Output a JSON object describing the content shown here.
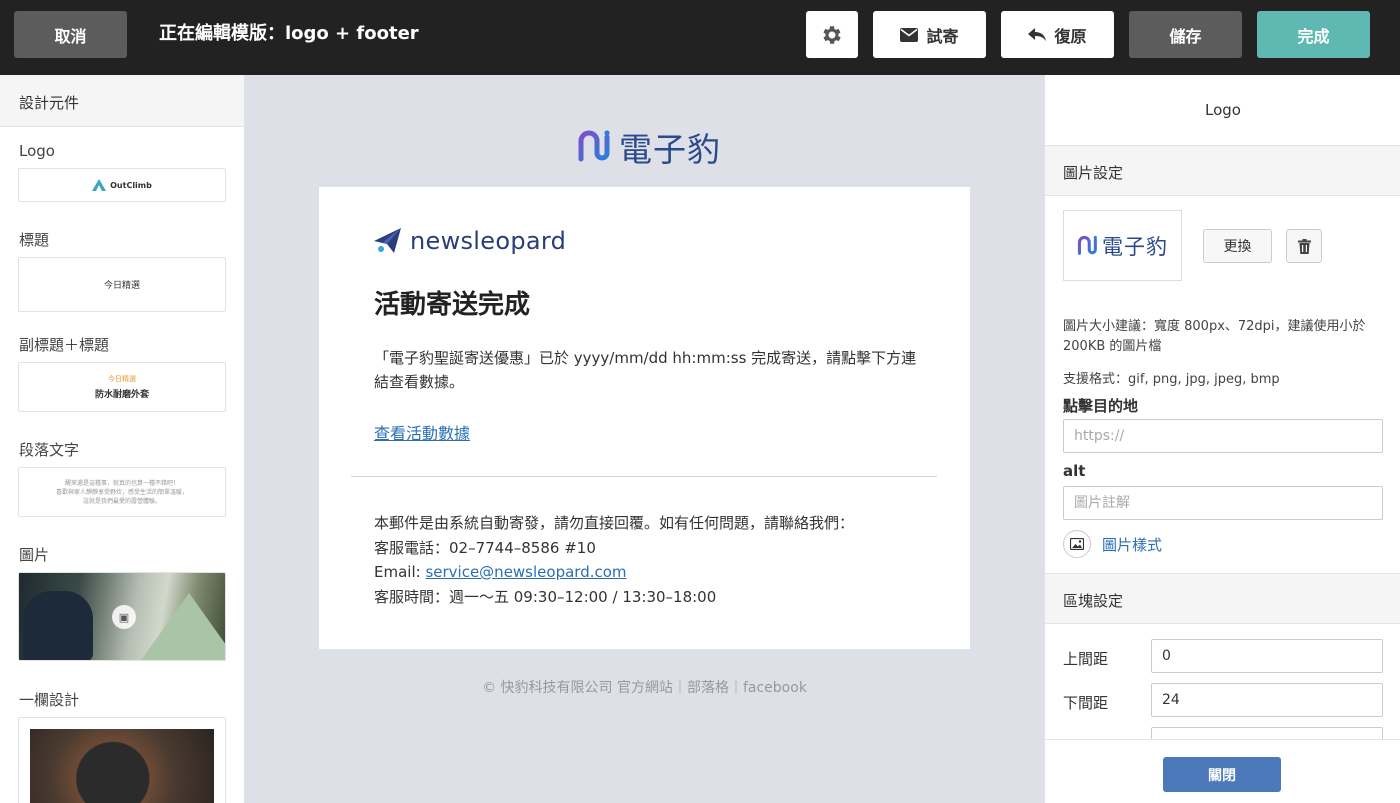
{
  "topbar": {
    "cancel_label": "取消",
    "title": "正在編輯模版：logo + footer",
    "test_send_label": "試寄",
    "restore_label": "復原",
    "save_label": "儲存",
    "done_label": "完成"
  },
  "left": {
    "header": "設計元件",
    "components": [
      {
        "label": "Logo",
        "preview": "OutClimb"
      },
      {
        "label": "標題",
        "preview": "今日精選"
      },
      {
        "label": "副標題＋標題",
        "preview_sub": "今日精選",
        "preview_title": "防水耐磨外套"
      },
      {
        "label": "段落文字",
        "preview_lines": [
          "醒來還是這種事，就真的也算一種不錯吧！",
          "喜歡與家人靜靜享受野炊，感受生活的簡單溫暖，",
          "這就是我們最愛的露營體驗。"
        ]
      },
      {
        "label": "圖片"
      },
      {
        "label": "一欄設計"
      }
    ]
  },
  "canvas": {
    "top_logo_text": "電子豹",
    "card": {
      "logo_text": "newsleopard",
      "heading": "活動寄送完成",
      "paragraph": "「電子豹聖誕寄送優惠」已於 yyyy/mm/dd hh:mm:ss 完成寄送，請點擊下方連結查看數據。",
      "link_text": "查看活動數據",
      "footer_line1": "本郵件是由系統自動寄發，請勿直接回覆。如有任何問題，請聯絡我們：",
      "footer_line2": "客服電話：02–7744–8586 #10",
      "footer_email_label": "Email: ",
      "footer_email": "service@newsleopard.com",
      "footer_line4": "客服時間：週一～五 09:30–12:00 / 13:30–18:00"
    },
    "copyright": "© 快豹科技有限公司 官方網站｜部落格｜facebook"
  },
  "right": {
    "title": "Logo",
    "image_section": "圖片設定",
    "thumb_text": "電子豹",
    "replace_label": "更換",
    "size_hint": "圖片大小建議：寬度 800px、72dpi，建議使用小於 200KB 的圖片檔",
    "formats": "支援格式：gif, png, jpg, jpeg, bmp",
    "click_dest_label": "點擊目的地",
    "click_dest_placeholder": "https://",
    "alt_label": "alt",
    "alt_placeholder": "圖片註解",
    "image_style_link": "圖片樣式",
    "block_section": "區塊設定",
    "top_padding_label": "上間距",
    "top_padding_value": "0",
    "bottom_padding_label": "下間距",
    "bottom_padding_value": "24",
    "close_label": "關閉"
  },
  "colors": {
    "topbar_bg": "#222222",
    "done_accent": "#5fb8b1",
    "brand_blue": "#2b4a8c",
    "link_blue": "#2a6fb5",
    "close_button": "#4b79b9"
  },
  "icons": [
    "gear-icon",
    "envelope-icon",
    "undo-arrow-icon",
    "trash-icon",
    "image-icon",
    "paper-plane-icon"
  ]
}
